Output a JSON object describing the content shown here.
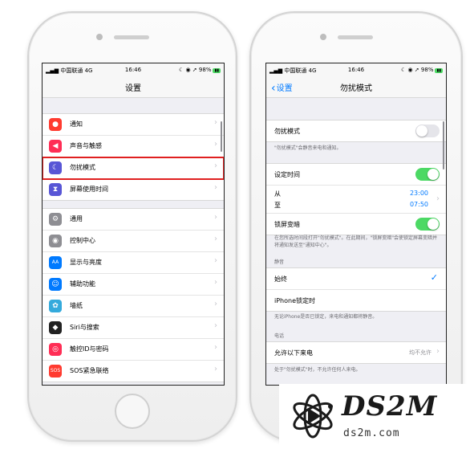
{
  "status": {
    "carrier": "中国联通 4G",
    "time": "16:46",
    "battery": "98%"
  },
  "screen1": {
    "title": "设置",
    "group1": [
      {
        "label": "通知",
        "icon": "notification-icon",
        "color": "#ff3b30",
        "glyph": "●"
      },
      {
        "label": "声音与触感",
        "icon": "speaker-icon",
        "color": "#ff2d55",
        "glyph": "◀"
      },
      {
        "label": "勿扰模式",
        "icon": "moon-icon",
        "color": "#5856d6",
        "glyph": "☾"
      },
      {
        "label": "屏幕使用时间",
        "icon": "hourglass-icon",
        "color": "#5856d6",
        "glyph": "⧗"
      }
    ],
    "group2": [
      {
        "label": "通用",
        "icon": "gear-icon",
        "color": "#8e8e93",
        "glyph": "⚙"
      },
      {
        "label": "控制中心",
        "icon": "control-center-icon",
        "color": "#8e8e93",
        "glyph": "◉"
      },
      {
        "label": "显示与亮度",
        "icon": "display-icon",
        "color": "#007aff",
        "glyph": "AA"
      },
      {
        "label": "辅助功能",
        "icon": "accessibility-icon",
        "color": "#007aff",
        "glyph": "☺"
      },
      {
        "label": "墙纸",
        "icon": "wallpaper-icon",
        "color": "#34aadc",
        "glyph": "✿"
      },
      {
        "label": "Siri与搜索",
        "icon": "siri-icon",
        "color": "#222222",
        "glyph": "◆"
      },
      {
        "label": "触控ID与密码",
        "icon": "fingerprint-icon",
        "color": "#ff2d55",
        "glyph": "◎"
      },
      {
        "label": "SOS紧急联络",
        "icon": "sos-icon",
        "color": "#ff3b30",
        "glyph": "SOS"
      }
    ]
  },
  "screen2": {
    "back_label": "设置",
    "title": "勿扰模式",
    "dnd_label": "勿扰模式",
    "dnd_note": "\"勿扰模式\"会静音来电和通知。",
    "scheduled_label": "设定时间",
    "from_label": "从",
    "to_label": "至",
    "from_time": "23:00",
    "to_time": "07:50",
    "dim_label": "锁屏变暗",
    "dim_note": "在您所选时间段打开\"勿扰模式\"。在此期间，\"锁屏变暗\"会使锁定屏幕变暗并将通知发送至\"通知中心\"。",
    "silence_header": "静音",
    "always_label": "始终",
    "locked_label": "iPhone锁定时",
    "silence_note": "无论iPhone是否已锁定，来电和通知都将静音。",
    "phone_header": "电话",
    "allow_calls_label": "允许以下来电",
    "allow_calls_value": "均不允许",
    "calls_note": "处于\"勿扰模式\"时，不允许任何人来电。"
  },
  "watermark": {
    "brand": "DS2M",
    "domain": "ds2m.com"
  },
  "colors": {
    "highlight": "#e02020",
    "toggle_on": "#4cd964",
    "link": "#007aff"
  }
}
